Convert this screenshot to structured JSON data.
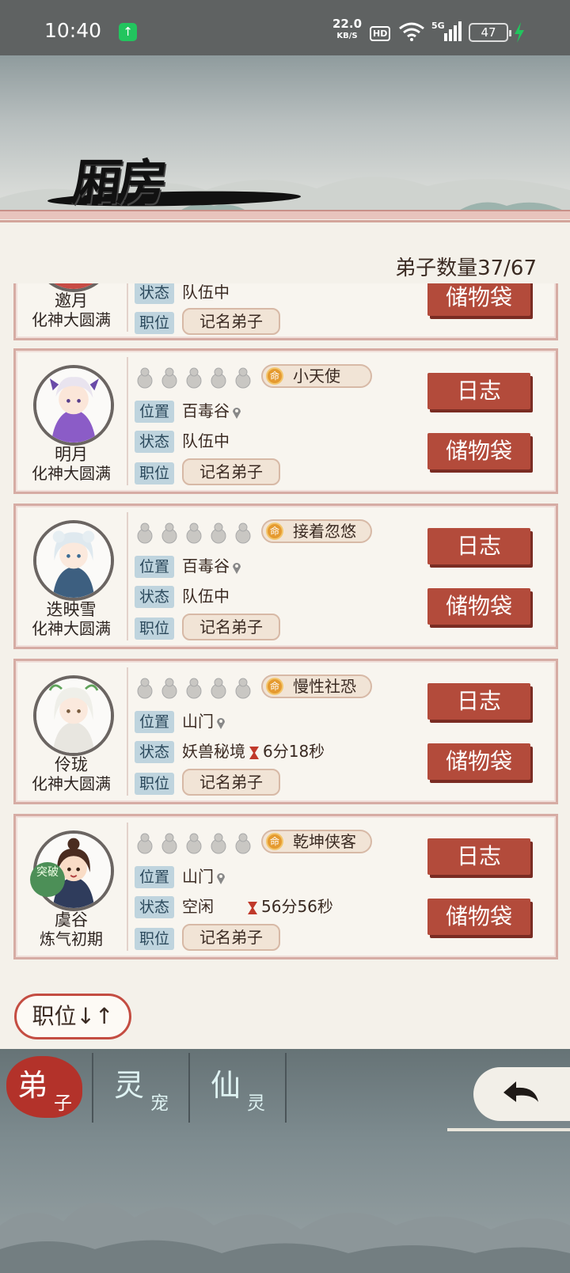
{
  "status_bar": {
    "time": "10:40",
    "speed_value": "22.0",
    "speed_unit": "KB/S",
    "hd": "HD",
    "network": "5G",
    "battery": "47"
  },
  "title": "厢房",
  "disciple_count": "弟子数量37/67",
  "labels": {
    "location": "位置",
    "status": "状态",
    "rank": "职位",
    "log_button": "日志",
    "bag_button": "储物袋"
  },
  "disciples": [
    {
      "name": "邀月",
      "realm": "化神大圆满",
      "status": "队伍中",
      "rank": "记名弟子"
    },
    {
      "name": "明月",
      "realm": "化神大圆满",
      "trait": "小天使",
      "location": "百毒谷",
      "status": "队伍中",
      "rank": "记名弟子"
    },
    {
      "name": "迭映雪",
      "realm": "化神大圆满",
      "trait": "接着忽悠",
      "location": "百毒谷",
      "status": "队伍中",
      "rank": "记名弟子"
    },
    {
      "name": "伶珑",
      "realm": "化神大圆满",
      "trait": "慢性社恐",
      "location": "山门",
      "status": "妖兽秘境",
      "timer": "6分18秒",
      "rank": "记名弟子"
    },
    {
      "name": "虞谷",
      "realm": "炼气初期",
      "badge": "突破",
      "trait": "乾坤侠客",
      "location": "山门",
      "status": "空闲",
      "timer": "56分56秒",
      "rank": "记名弟子"
    }
  ],
  "trait_icon": "命",
  "sort_button": "职位↓↑",
  "tabs": [
    {
      "big": "弟",
      "small": "子"
    },
    {
      "big": "灵",
      "small": "宠"
    },
    {
      "big": "仙",
      "small": "灵"
    }
  ],
  "colors": {
    "button_red": "#b34b3b",
    "label_blue": "#bfd4de",
    "panel": "#f4f1ea"
  }
}
